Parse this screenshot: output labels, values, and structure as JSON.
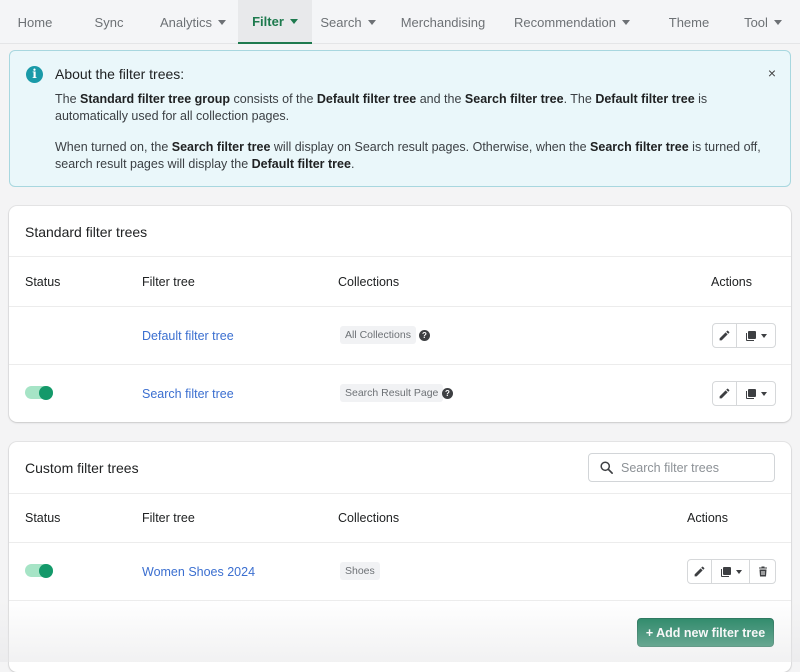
{
  "nav": {
    "items": [
      {
        "label": "Home",
        "dropdown": false,
        "active": false
      },
      {
        "label": "Sync",
        "dropdown": false,
        "active": false
      },
      {
        "label": "Analytics",
        "dropdown": true,
        "active": false
      },
      {
        "label": "Filter",
        "dropdown": true,
        "active": true
      },
      {
        "label": "Search",
        "dropdown": true,
        "active": false
      },
      {
        "label": "Merchandising",
        "dropdown": false,
        "active": false
      },
      {
        "label": "Recommendation",
        "dropdown": true,
        "active": false
      },
      {
        "label": "Theme",
        "dropdown": false,
        "active": false
      },
      {
        "label": "Tool",
        "dropdown": true,
        "active": false
      }
    ]
  },
  "banner": {
    "icon": "info-icon",
    "title": "About the filter trees:",
    "close": "×",
    "p1": {
      "t1": "The ",
      "b1": "Standard filter tree group",
      "t2": " consists of the ",
      "b2": "Default filter tree",
      "t3": " and the ",
      "b3": "Search filter tree",
      "t4": ". The ",
      "b4": "Default filter tree",
      "t5": " is automatically used for all collection pages."
    },
    "p2": {
      "t1": "When turned on, the ",
      "b1": "Search filter tree",
      "t2": " will display on Search result pages. Otherwise, when the ",
      "b2": "Search filter tree",
      "t3": " is turned off, search result pages will display the ",
      "b3": "Default filter tree",
      "t4": "."
    }
  },
  "standard": {
    "title": "Standard filter trees",
    "columns": {
      "status": "Status",
      "filter_tree": "Filter tree",
      "collections": "Collections",
      "actions": "Actions"
    },
    "rows": [
      {
        "status": null,
        "name": "Default filter tree",
        "collection": "All Collections",
        "help": "?"
      },
      {
        "status": "on",
        "name": "Search filter tree",
        "collection": "Search Result Page",
        "help": "?"
      }
    ]
  },
  "custom": {
    "title": "Custom filter trees",
    "search_placeholder": "Search filter trees",
    "search_value": "",
    "columns": {
      "status": "Status",
      "filter_tree": "Filter tree",
      "collections": "Collections",
      "actions": "Actions"
    },
    "rows": [
      {
        "status": "on",
        "name": "Women Shoes 2024",
        "collection": "Shoes"
      }
    ],
    "add_button": "+ Add new filter tree"
  },
  "colors": {
    "accent": "#1e7a4e",
    "primary_button": "#0f7a55",
    "link": "#3b6fd0",
    "toggle_on": "#14996a",
    "banner_bg": "#eaf7fa",
    "info_icon": "#1a9aa8"
  }
}
